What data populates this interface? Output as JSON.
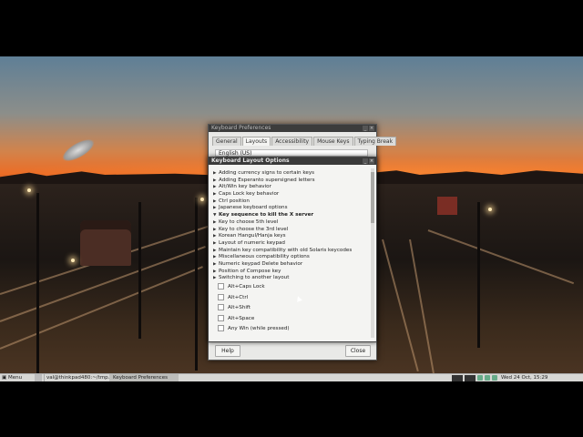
{
  "prefs_window": {
    "title": "Keyboard Preferences",
    "tabs": [
      "General",
      "Layouts",
      "Accessibility",
      "Mouse Keys",
      "Typing Break"
    ],
    "active_tab": "Layouts",
    "layout_value": "English (US)",
    "help_label": "Help",
    "close_label": "Close"
  },
  "options_window": {
    "title": "Keyboard Layout Options",
    "groups": [
      "Adding currency signs to certain keys",
      "Adding Esperanto supersigned letters",
      "Alt/Win key behavior",
      "Caps Lock key behavior",
      "Ctrl position",
      "Japanese keyboard options",
      "Key sequence to kill the X server",
      "Key to choose 5th level",
      "Key to choose the 3rd level",
      "Korean Hangul/Hanja keys",
      "Layout of numeric keypad",
      "Maintain key compatibility with old Solaris keycodes",
      "Miscellaneous compatibility options",
      "Numeric keypad Delete behavior",
      "Position of Compose key",
      "Switching to another layout"
    ],
    "expanded_group": "Key sequence to kill the X server",
    "suboptions": [
      "Alt+Caps Lock",
      "Alt+Ctrl",
      "Alt+Shift",
      "Alt+Space",
      "Any Win (while pressed)"
    ]
  },
  "taskbar": {
    "menu_label": "Menu",
    "terminal_task": "val@thinkpad480:~/tmp...",
    "prefs_task": "Keyboard Preferences",
    "clock": "Wed 24 Oct, 15:29"
  }
}
